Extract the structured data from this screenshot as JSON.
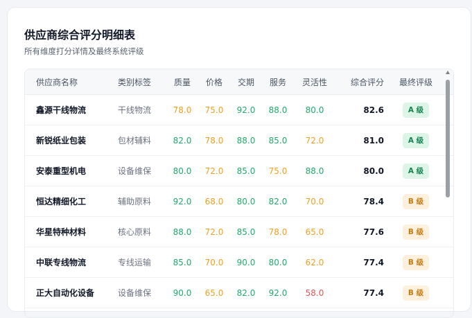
{
  "header": {
    "title": "供应商综合评分明细表",
    "subtitle": "所有维度打分详情及最终系统评级"
  },
  "columns": {
    "name": "供应商名称",
    "category": "类别标签",
    "quality": "质量",
    "price": "价格",
    "delivery": "交期",
    "service": "服务",
    "flexibility": "灵活性",
    "total": "综合评分",
    "grade": "最终评级"
  },
  "colors": {
    "green": "#1faa6a",
    "orange": "#f0a020",
    "red": "#e25555",
    "grade_a_bg": "#dcf5e7",
    "grade_a_text": "#15834f",
    "grade_b_bg": "#fdf0dc",
    "grade_b_text": "#c77a13"
  },
  "rows": [
    {
      "name": "鑫源干线物流",
      "category": "干线物流",
      "quality": "78.0",
      "price": "75.0",
      "delivery": "92.0",
      "service": "88.0",
      "flexibility": "80.0",
      "total": "82.6",
      "grade": "A 级",
      "tones": {
        "quality": "orange",
        "price": "orange",
        "delivery": "green",
        "service": "green",
        "flexibility": "green"
      },
      "grade_tone": "a"
    },
    {
      "name": "新锐纸业包装",
      "category": "包材辅料",
      "quality": "82.0",
      "price": "78.0",
      "delivery": "88.0",
      "service": "85.0",
      "flexibility": "72.0",
      "total": "81.0",
      "grade": "A 级",
      "tones": {
        "quality": "green",
        "price": "orange",
        "delivery": "green",
        "service": "green",
        "flexibility": "orange"
      },
      "grade_tone": "a"
    },
    {
      "name": "安泰重型机电",
      "category": "设备维保",
      "quality": "80.0",
      "price": "72.0",
      "delivery": "85.0",
      "service": "75.0",
      "flexibility": "88.0",
      "total": "80.0",
      "grade": "A 级",
      "tones": {
        "quality": "green",
        "price": "orange",
        "delivery": "green",
        "service": "orange",
        "flexibility": "green"
      },
      "grade_tone": "a"
    },
    {
      "name": "恒达精细化工",
      "category": "辅助原料",
      "quality": "92.0",
      "price": "68.0",
      "delivery": "80.0",
      "service": "82.0",
      "flexibility": "70.0",
      "total": "78.4",
      "grade": "B 级",
      "tones": {
        "quality": "green",
        "price": "orange",
        "delivery": "green",
        "service": "green",
        "flexibility": "orange"
      },
      "grade_tone": "b"
    },
    {
      "name": "华星特种材料",
      "category": "核心原料",
      "quality": "88.0",
      "price": "72.0",
      "delivery": "85.0",
      "service": "78.0",
      "flexibility": "65.0",
      "total": "77.6",
      "grade": "B 级",
      "tones": {
        "quality": "green",
        "price": "orange",
        "delivery": "green",
        "service": "orange",
        "flexibility": "orange"
      },
      "grade_tone": "b"
    },
    {
      "name": "中联专线物流",
      "category": "专线运输",
      "quality": "85.0",
      "price": "70.0",
      "delivery": "90.0",
      "service": "80.0",
      "flexibility": "62.0",
      "total": "77.4",
      "grade": "B 级",
      "tones": {
        "quality": "green",
        "price": "orange",
        "delivery": "green",
        "service": "green",
        "flexibility": "orange"
      },
      "grade_tone": "b"
    },
    {
      "name": "正大自动化设备",
      "category": "设备维保",
      "quality": "90.0",
      "price": "65.0",
      "delivery": "82.0",
      "service": "92.0",
      "flexibility": "58.0",
      "total": "77.4",
      "grade": "B 级",
      "tones": {
        "quality": "green",
        "price": "orange",
        "delivery": "green",
        "service": "green",
        "flexibility": "red"
      },
      "grade_tone": "b"
    }
  ]
}
